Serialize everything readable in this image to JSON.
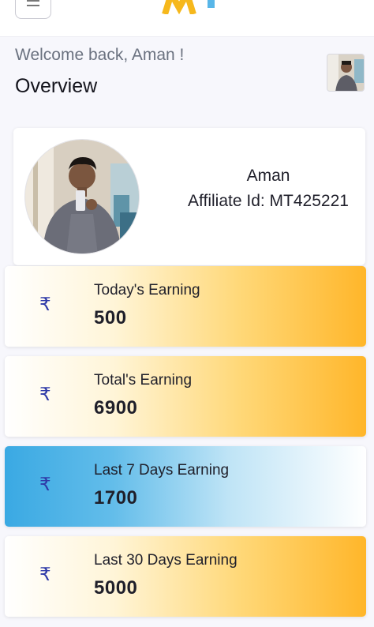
{
  "header": {
    "logo_text": "M",
    "welcome": "Welcome back, Aman !",
    "title": "Overview"
  },
  "profile": {
    "name": "Aman",
    "affiliate": "Affiliate Id: MT425221"
  },
  "earnings": [
    {
      "label": "Today's Earning",
      "value": "500",
      "currency_icon": "rupee-icon"
    },
    {
      "label": "Total's Earning",
      "value": "6900",
      "currency_icon": "rupee-icon"
    },
    {
      "label": "Last 7 Days Earning",
      "value": "1700",
      "currency_icon": "rupee-icon"
    },
    {
      "label": "Last 30 Days Earning",
      "value": "5000",
      "currency_icon": "rupee-icon"
    }
  ],
  "symbols": {
    "rupee": "₹"
  },
  "colors": {
    "accent_orange": "#ffb62a",
    "accent_blue": "#3aa9e3",
    "rupee": "#2f3aa8"
  }
}
